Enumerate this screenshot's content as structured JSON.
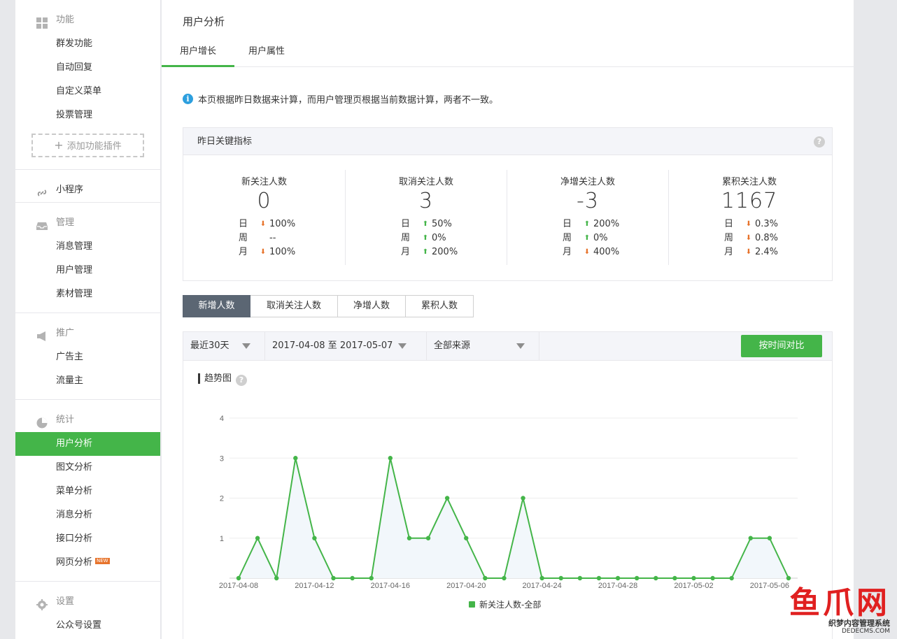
{
  "sidebar": {
    "groups": [
      {
        "title": "功能",
        "icon": "grid-icon",
        "items": [
          "群发功能",
          "自动回复",
          "自定义菜单",
          "投票管理"
        ],
        "add_plugin": "添加功能插件"
      },
      {
        "title": "小程序",
        "icon": "link-icon",
        "items": []
      },
      {
        "title": "管理",
        "icon": "inbox-icon",
        "items": [
          "消息管理",
          "用户管理",
          "素材管理"
        ]
      },
      {
        "title": "推广",
        "icon": "megaphone-icon",
        "items": [
          "广告主",
          "流量主"
        ]
      },
      {
        "title": "统计",
        "icon": "pie-chart-icon",
        "items": [
          "用户分析",
          "图文分析",
          "菜单分析",
          "消息分析",
          "接口分析",
          "网页分析"
        ],
        "active": "用户分析",
        "new_badge": "NEW"
      },
      {
        "title": "设置",
        "icon": "gear-icon",
        "items": [
          "公众号设置",
          "微信认证"
        ]
      }
    ]
  },
  "main": {
    "title": "用户分析",
    "tabs": [
      {
        "label": "用户增长",
        "active": true
      },
      {
        "label": "用户属性",
        "active": false
      }
    ],
    "notice": "本页根据昨日数据来计算，而用户管理页根据当前数据计算，两者不一致。",
    "kpi": {
      "heading": "昨日关键指标",
      "columns": [
        {
          "label": "新关注人数",
          "value": "0",
          "rows": [
            {
              "k": "日",
              "dir": "down",
              "v": "100%"
            },
            {
              "k": "周",
              "dir": "none",
              "v": "--"
            },
            {
              "k": "月",
              "dir": "down",
              "v": "100%"
            }
          ]
        },
        {
          "label": "取消关注人数",
          "value": "3",
          "rows": [
            {
              "k": "日",
              "dir": "up",
              "v": "50%"
            },
            {
              "k": "周",
              "dir": "up",
              "v": "0%"
            },
            {
              "k": "月",
              "dir": "up",
              "v": "200%"
            }
          ]
        },
        {
          "label": "净增关注人数",
          "value": "-3",
          "rows": [
            {
              "k": "日",
              "dir": "up",
              "v": "200%"
            },
            {
              "k": "周",
              "dir": "up",
              "v": "0%"
            },
            {
              "k": "月",
              "dir": "down",
              "v": "400%"
            }
          ]
        },
        {
          "label": "累积关注人数",
          "value": "1167",
          "rows": [
            {
              "k": "日",
              "dir": "down",
              "v": "0.3%"
            },
            {
              "k": "周",
              "dir": "down",
              "v": "0.8%"
            },
            {
              "k": "月",
              "dir": "down",
              "v": "2.4%"
            }
          ]
        }
      ]
    },
    "sub_tabs": [
      "新增人数",
      "取消关注人数",
      "净增人数",
      "累积人数"
    ],
    "sub_tab_active": "新增人数",
    "filters": {
      "range": "最近30天",
      "dates": "2017-04-08 至 2017-05-07",
      "source": "全部来源",
      "compare_button": "按时间对比"
    },
    "chart_title": "趋势图"
  },
  "colors": {
    "accent": "#44b549",
    "up": "#44b549",
    "down": "#e7732b",
    "info": "#2d9fde"
  },
  "chart_data": {
    "type": "line",
    "title": "趋势图",
    "x": [
      "2017-04-08",
      "2017-04-09",
      "2017-04-10",
      "2017-04-11",
      "2017-04-12",
      "2017-04-13",
      "2017-04-14",
      "2017-04-15",
      "2017-04-16",
      "2017-04-17",
      "2017-04-18",
      "2017-04-19",
      "2017-04-20",
      "2017-04-21",
      "2017-04-22",
      "2017-04-23",
      "2017-04-24",
      "2017-04-25",
      "2017-04-26",
      "2017-04-27",
      "2017-04-28",
      "2017-04-29",
      "2017-04-30",
      "2017-05-01",
      "2017-05-02",
      "2017-05-03",
      "2017-05-04",
      "2017-05-05",
      "2017-05-06",
      "2017-05-07"
    ],
    "x_tick_labels": [
      "2017-04-08",
      "2017-04-12",
      "2017-04-16",
      "2017-04-20",
      "2017-04-24",
      "2017-04-28",
      "2017-05-02",
      "2017-05-06"
    ],
    "series": [
      {
        "name": "新关注人数-全部",
        "values": [
          0,
          1,
          0,
          3,
          1,
          0,
          0,
          0,
          3,
          1,
          1,
          2,
          1,
          0,
          0,
          2,
          0,
          0,
          0,
          0,
          0,
          0,
          0,
          0,
          0,
          0,
          0,
          1,
          1,
          0
        ]
      }
    ],
    "ylim": [
      0,
      4
    ],
    "y_ticks": [
      1,
      2,
      3,
      4
    ],
    "legend": "bottom-center",
    "grid": true
  },
  "watermark": {
    "big": "鱼爪网",
    "small": "织梦内容管理系统",
    "url": "DEDECMS.COM"
  }
}
